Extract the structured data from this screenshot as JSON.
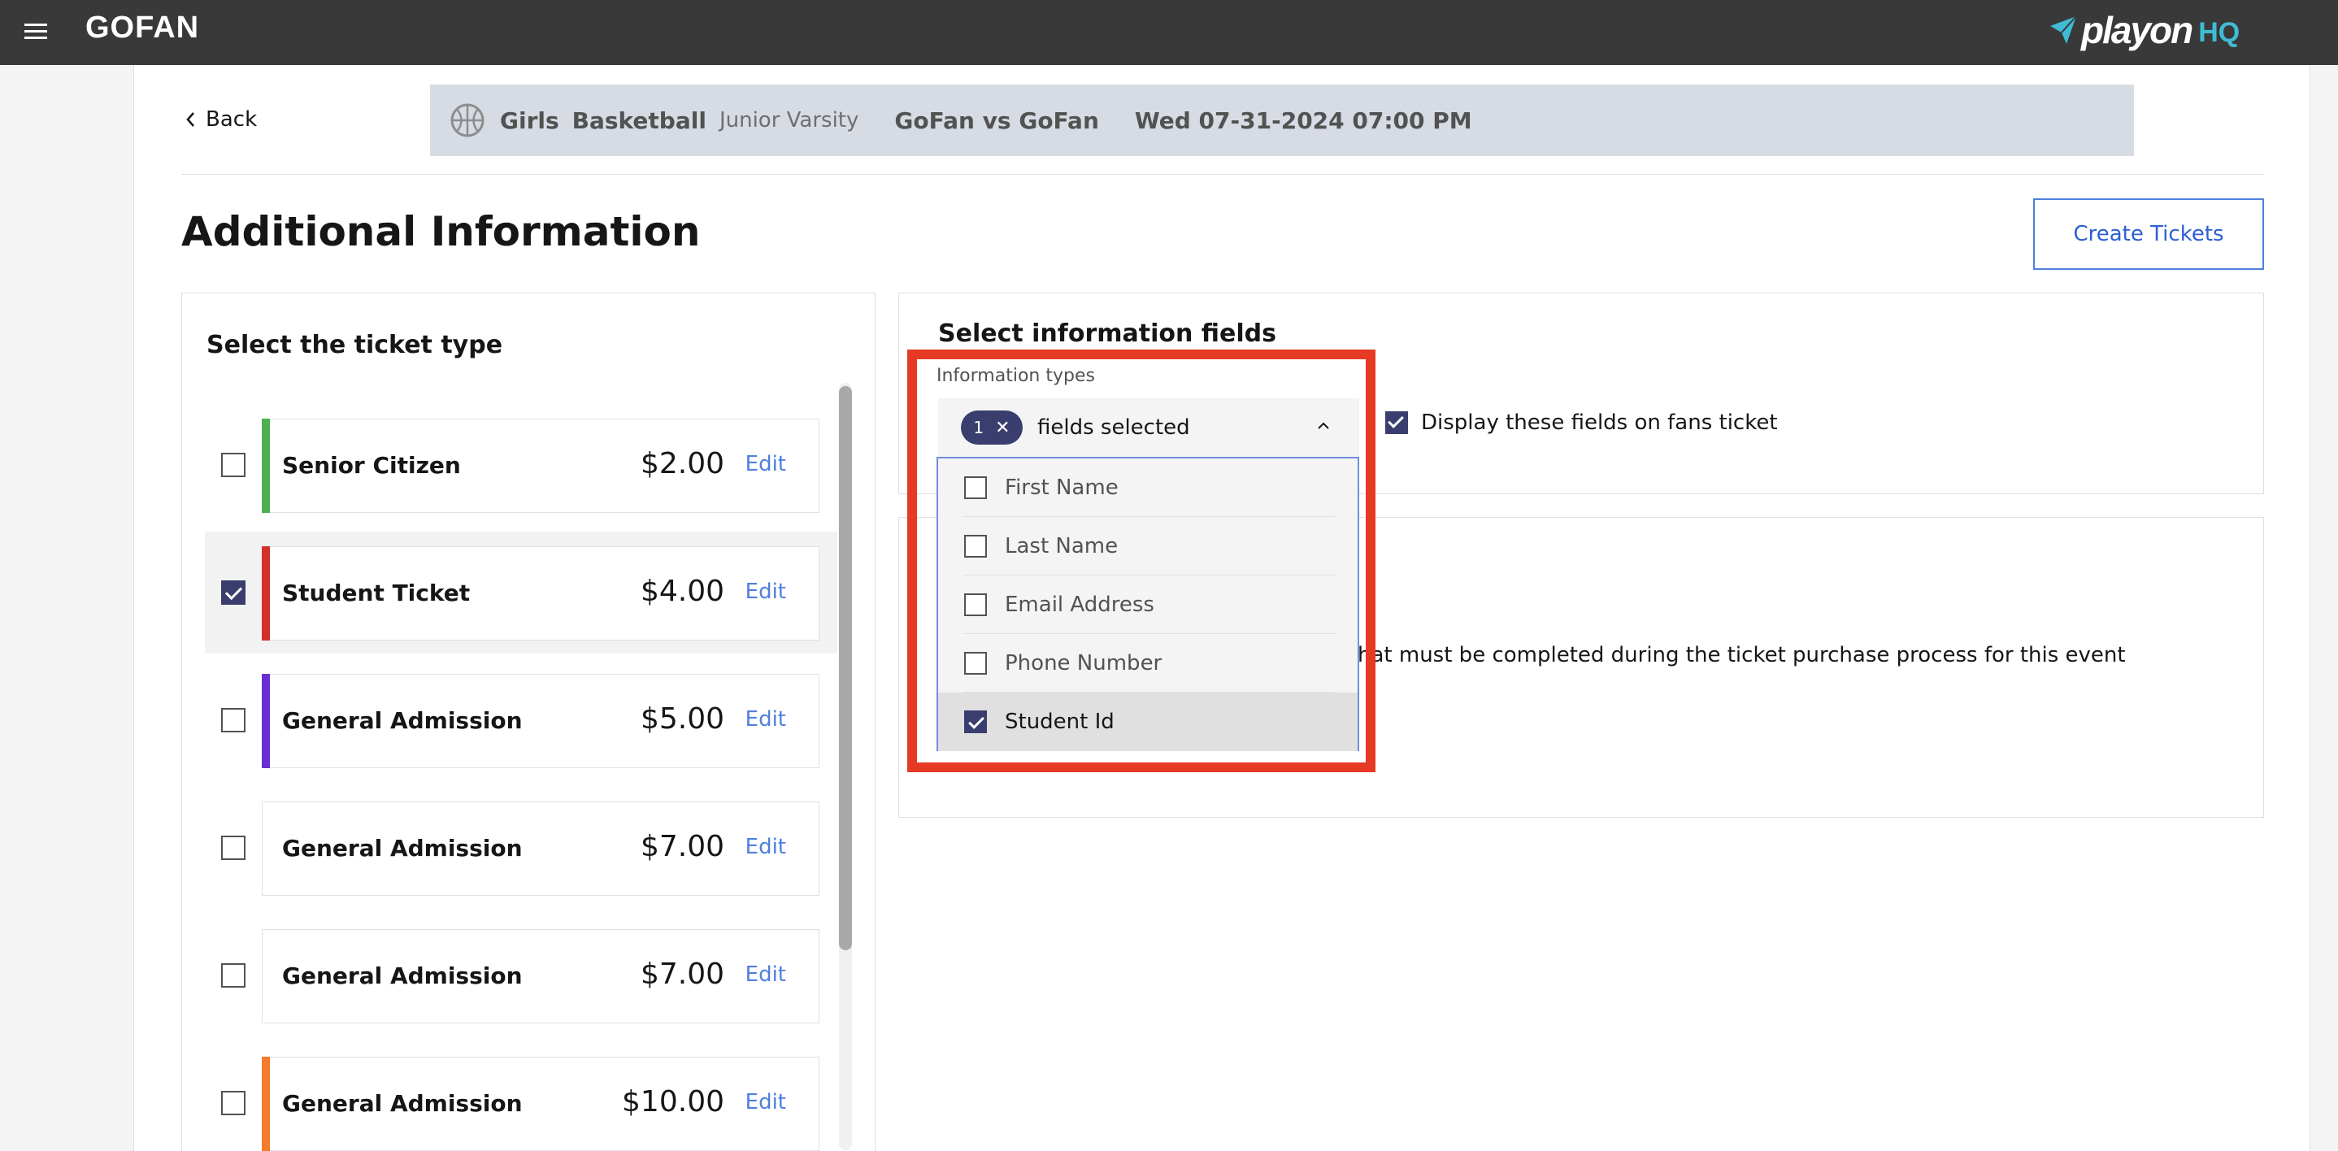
{
  "topbar": {
    "brand": "GOFAN",
    "logo_word": "playon",
    "logo_suffix": "HQ",
    "menu_icon": "hamburger-icon"
  },
  "nav": {
    "back_label": "Back"
  },
  "event": {
    "gender": "Girls",
    "sport": "Basketball",
    "level": "Junior Varsity",
    "matchup": "GoFan vs GoFan",
    "datetime": "Wed 07-31-2024 07:00 PM",
    "sport_icon": "basketball-icon"
  },
  "page": {
    "title": "Additional Information",
    "create_button": "Create Tickets"
  },
  "ticket_panel": {
    "heading": "Select the ticket type",
    "edit_label": "Edit",
    "tickets": [
      {
        "name": "Senior Citizen",
        "price": "$2.00",
        "checked": false,
        "accent": "#4caf50"
      },
      {
        "name": "Student Ticket",
        "price": "$4.00",
        "checked": true,
        "accent": "#d32f2f"
      },
      {
        "name": "General Admission",
        "price": "$5.00",
        "checked": false,
        "accent": "#6a2fd3"
      },
      {
        "name": "General Admission",
        "price": "$7.00",
        "checked": false,
        "accent": ""
      },
      {
        "name": "General Admission",
        "price": "$7.00",
        "checked": false,
        "accent": ""
      },
      {
        "name": "General Admission",
        "price": "$10.00",
        "checked": false,
        "accent": "#f37b2b"
      }
    ]
  },
  "info_panel": {
    "heading": "Select information fields",
    "types_label": "Information types",
    "selected_count": "1",
    "selected_text": "fields selected",
    "display_label": "Display these fields on fans ticket",
    "display_checked": true,
    "options": [
      {
        "label": "First Name",
        "checked": false
      },
      {
        "label": "Last Name",
        "checked": false
      },
      {
        "label": "Email Address",
        "checked": false
      },
      {
        "label": "Phone Number",
        "checked": false
      },
      {
        "label": "Student Id",
        "checked": true
      }
    ],
    "description_fragment": "s that must be completed during the ticket purchase process for this event"
  },
  "colors": {
    "topbar": "#393939",
    "accent_blue": "#4f7fe0",
    "checkbox": "#393e6e",
    "highlight": "#e63a24"
  }
}
